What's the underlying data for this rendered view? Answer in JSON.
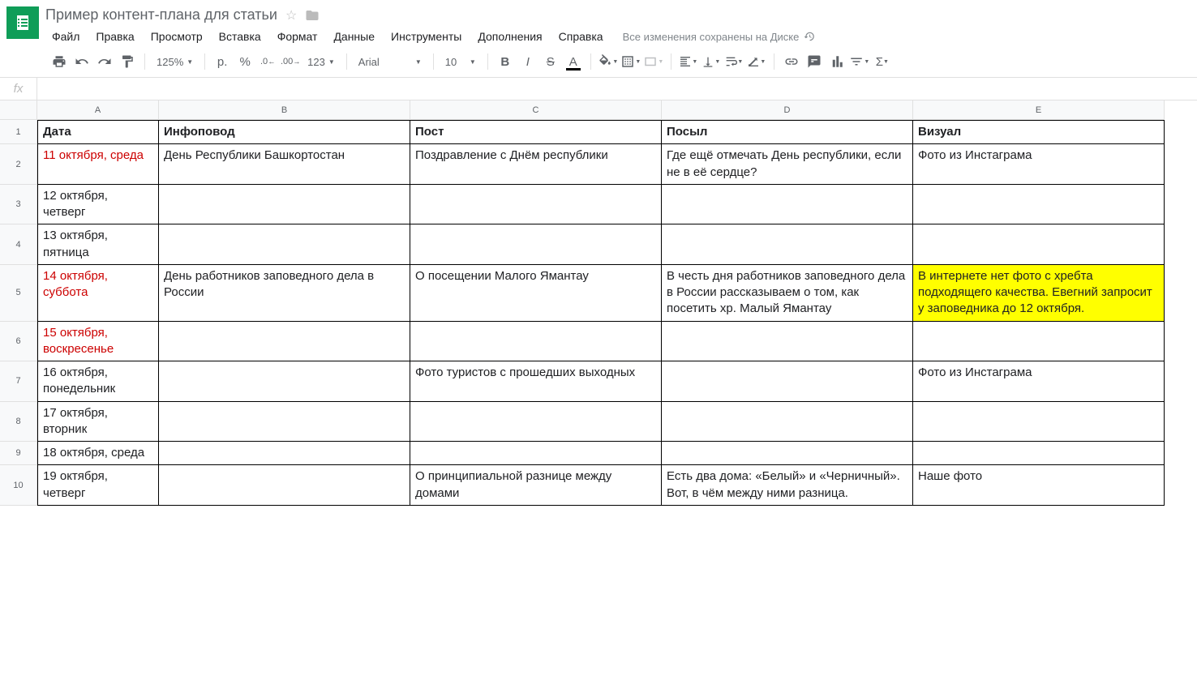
{
  "doc": {
    "title": "Пример контент-плана для статьи"
  },
  "menu": {
    "file": "Файл",
    "edit": "Правка",
    "view": "Просмотр",
    "insert": "Вставка",
    "format": "Формат",
    "data": "Данные",
    "tools": "Инструменты",
    "addons": "Дополнения",
    "help": "Справка",
    "save_status": "Все изменения сохранены на Диске"
  },
  "toolbar": {
    "zoom": "125%",
    "currency": "р.",
    "percent": "%",
    "dec_dec": ".0",
    "inc_dec": ".00",
    "num_fmt": "123",
    "font": "Arial",
    "size": "10"
  },
  "columns": [
    "A",
    "B",
    "C",
    "D",
    "E"
  ],
  "headers": {
    "A": "Дата",
    "B": "Инфоповод",
    "C": "Пост",
    "D": "Посыл",
    "E": "Визуал"
  },
  "rows": [
    {
      "n": "1"
    },
    {
      "n": "2",
      "A": "11 октября, среда",
      "A_red": true,
      "B": "День Республики Башкортостан",
      "C": "Поздравление с Днём республики",
      "D": "Где ещё отмечать День республики, если не в её сердце?",
      "E": "Фото из Инстаграма"
    },
    {
      "n": "3",
      "A": "12 октября, четверг"
    },
    {
      "n": "4",
      "A": "13 октября, пятница"
    },
    {
      "n": "5",
      "A": "14 октября, суббота",
      "A_red": true,
      "B": "День работников заповедного дела в России",
      "C": "О посещении Малого Ямантау",
      "D": "В честь дня работников заповедного дела в России рассказываем о том, как посетить хр. Малый Ямантау",
      "E": "В интернете нет фото с хребта подходящего качества. Евегний запросит у заповедника до 12 октября.",
      "E_hl": true
    },
    {
      "n": "6",
      "A": "15 октября, воскресенье",
      "A_red": true
    },
    {
      "n": "7",
      "A": "16 октября, понедельник",
      "C": "Фото туристов с прошедших выходных",
      "E": "Фото из Инстаграма"
    },
    {
      "n": "8",
      "A": "17 октября, вторник"
    },
    {
      "n": "9",
      "A": "18 октября, среда"
    },
    {
      "n": "10",
      "A": "19 октября, четверг",
      "C": "О принципиальной разнице между домами",
      "D": "Есть два дома: «Белый» и «Черничный». Вот, в чём между ними разница.",
      "E": "Наше фото"
    }
  ]
}
